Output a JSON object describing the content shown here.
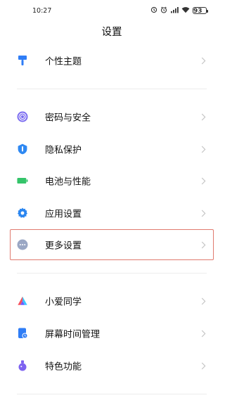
{
  "status_bar": {
    "time": "10:27",
    "icons": [
      "alarm-sync-icon",
      "alarm-clock-icon",
      "cellular-signal-icon",
      "wifi-icon"
    ],
    "battery": "93"
  },
  "header": {
    "title": "设置"
  },
  "sections": [
    {
      "items": [
        {
          "id": "theme",
          "label": "个性主题",
          "icon": "paintbrush-icon",
          "color": "#2f7df6"
        }
      ]
    },
    {
      "items": [
        {
          "id": "password-security",
          "label": "密码与安全",
          "icon": "fingerprint-target-icon",
          "color": "#7b6cf0"
        },
        {
          "id": "privacy",
          "label": "隐私保护",
          "icon": "privacy-shield-icon",
          "color": "#2e88f2"
        },
        {
          "id": "battery",
          "label": "电池与性能",
          "icon": "battery-icon",
          "color": "#34c46a"
        },
        {
          "id": "app-settings",
          "label": "应用设置",
          "icon": "gear-icon",
          "color": "#2b86f0"
        },
        {
          "id": "more-settings",
          "label": "更多设置",
          "icon": "more-dots-icon",
          "color": "#9aa7c4",
          "highlighted": true
        }
      ]
    },
    {
      "items": [
        {
          "id": "xiaoai",
          "label": "小爱同学",
          "icon": "xiaoai-logo-icon",
          "color": "#5b6df8"
        },
        {
          "id": "screen-time",
          "label": "屏幕时间管理",
          "icon": "screen-time-icon",
          "color": "#2f7df6"
        },
        {
          "id": "special-features",
          "label": "特色功能",
          "icon": "flask-icon",
          "color": "#7d62f0"
        }
      ]
    }
  ],
  "colors": {
    "highlight_border": "#e07a6e",
    "chevron": "#c4c4c4",
    "divider": "#ececec"
  }
}
